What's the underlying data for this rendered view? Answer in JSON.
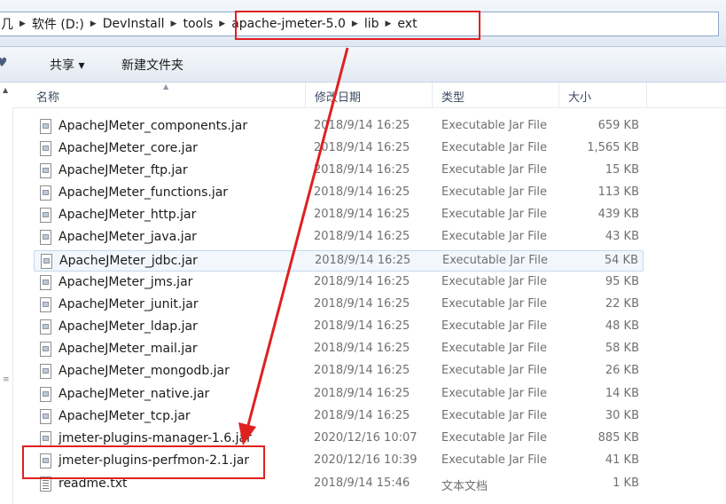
{
  "address_bar": {
    "partial_left": "几",
    "crumbs": [
      "软件 (D:)",
      "DevInstall",
      "tools",
      "apache-jmeter-5.0",
      "lib",
      "ext"
    ]
  },
  "toolbar": {
    "share_label": "共享 ▾",
    "new_folder_label": "新建文件夹",
    "left_partial": "♥"
  },
  "columns": {
    "name": "名称",
    "date": "修改日期",
    "type": "类型",
    "size": "大小"
  },
  "files": [
    {
      "name": "ApacheJMeter_components.jar",
      "date": "2018/9/14 16:25",
      "type": "Executable Jar File",
      "size": "659 KB"
    },
    {
      "name": "ApacheJMeter_core.jar",
      "date": "2018/9/14 16:25",
      "type": "Executable Jar File",
      "size": "1,565 KB"
    },
    {
      "name": "ApacheJMeter_ftp.jar",
      "date": "2018/9/14 16:25",
      "type": "Executable Jar File",
      "size": "15 KB"
    },
    {
      "name": "ApacheJMeter_functions.jar",
      "date": "2018/9/14 16:25",
      "type": "Executable Jar File",
      "size": "113 KB"
    },
    {
      "name": "ApacheJMeter_http.jar",
      "date": "2018/9/14 16:25",
      "type": "Executable Jar File",
      "size": "439 KB"
    },
    {
      "name": "ApacheJMeter_java.jar",
      "date": "2018/9/14 16:25",
      "type": "Executable Jar File",
      "size": "43 KB"
    },
    {
      "name": "ApacheJMeter_jdbc.jar",
      "date": "2018/9/14 16:25",
      "type": "Executable Jar File",
      "size": "54 KB"
    },
    {
      "name": "ApacheJMeter_jms.jar",
      "date": "2018/9/14 16:25",
      "type": "Executable Jar File",
      "size": "95 KB"
    },
    {
      "name": "ApacheJMeter_junit.jar",
      "date": "2018/9/14 16:25",
      "type": "Executable Jar File",
      "size": "22 KB"
    },
    {
      "name": "ApacheJMeter_ldap.jar",
      "date": "2018/9/14 16:25",
      "type": "Executable Jar File",
      "size": "48 KB"
    },
    {
      "name": "ApacheJMeter_mail.jar",
      "date": "2018/9/14 16:25",
      "type": "Executable Jar File",
      "size": "58 KB"
    },
    {
      "name": "ApacheJMeter_mongodb.jar",
      "date": "2018/9/14 16:25",
      "type": "Executable Jar File",
      "size": "26 KB"
    },
    {
      "name": "ApacheJMeter_native.jar",
      "date": "2018/9/14 16:25",
      "type": "Executable Jar File",
      "size": "14 KB"
    },
    {
      "name": "ApacheJMeter_tcp.jar",
      "date": "2018/9/14 16:25",
      "type": "Executable Jar File",
      "size": "30 KB"
    },
    {
      "name": "jmeter-plugins-manager-1.6.jar",
      "date": "2020/12/16 10:07",
      "type": "Executable Jar File",
      "size": "885 KB"
    },
    {
      "name": "jmeter-plugins-perfmon-2.1.jar",
      "date": "2020/12/16 10:39",
      "type": "Executable Jar File",
      "size": "41 KB"
    },
    {
      "name": "readme.txt",
      "date": "2018/9/14 15:46",
      "type": "文本文档",
      "size": "1 KB"
    }
  ],
  "colors": {
    "annotation": "#e02020",
    "hover_row": "#f2f7fd"
  }
}
